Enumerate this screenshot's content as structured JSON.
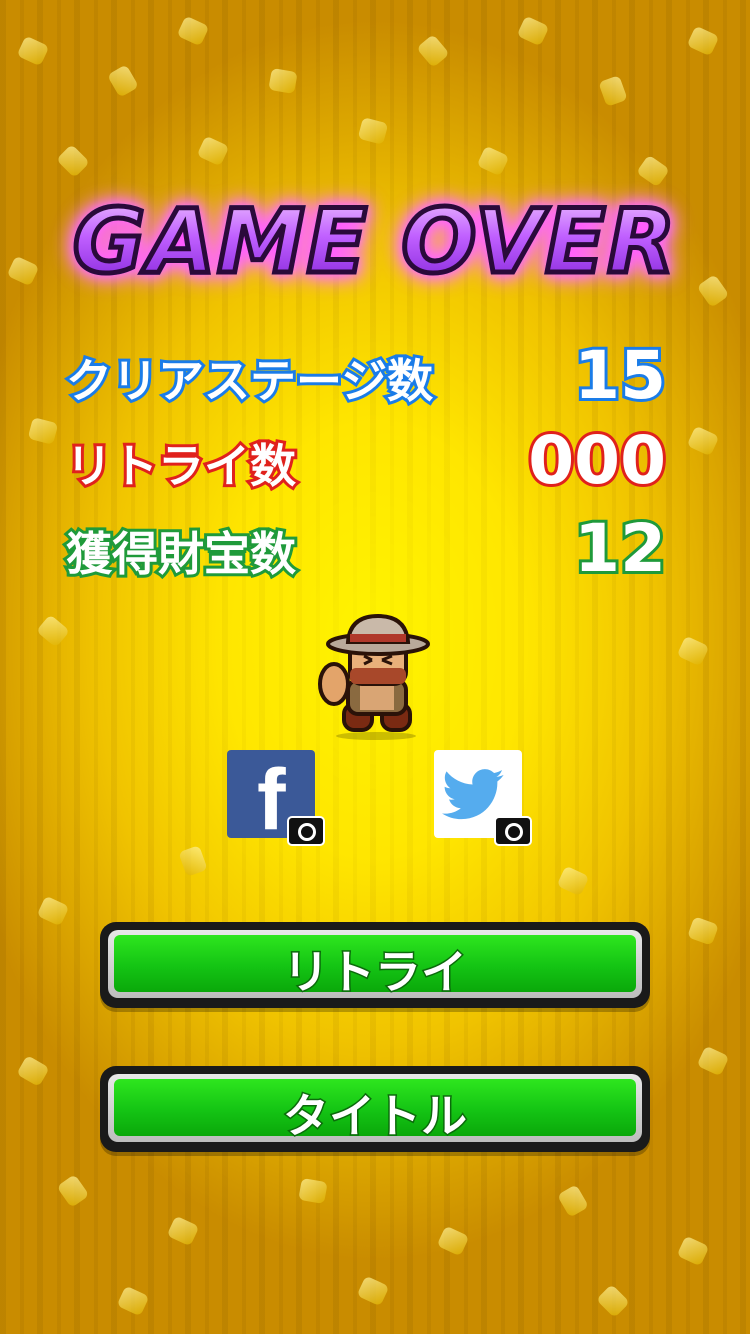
{
  "title": "GAME OVER",
  "stats": [
    {
      "label": "クリアステージ数",
      "value": "15"
    },
    {
      "label": "リトライ数",
      "value": "000"
    },
    {
      "label": "獲得財宝数",
      "value": "12"
    }
  ],
  "share": {
    "facebook_icon": "facebook-icon",
    "twitter_icon": "twitter-icon",
    "camera_icon": "camera-icon"
  },
  "buttons": {
    "retry": "リトライ",
    "title": "タイトル"
  },
  "colors": {
    "clear_stage": "#1a7ce8",
    "retry_count": "#e0211c",
    "treasure": "#1f9a3a",
    "button_green": "#14c414",
    "title_purple": "#c060ff"
  }
}
